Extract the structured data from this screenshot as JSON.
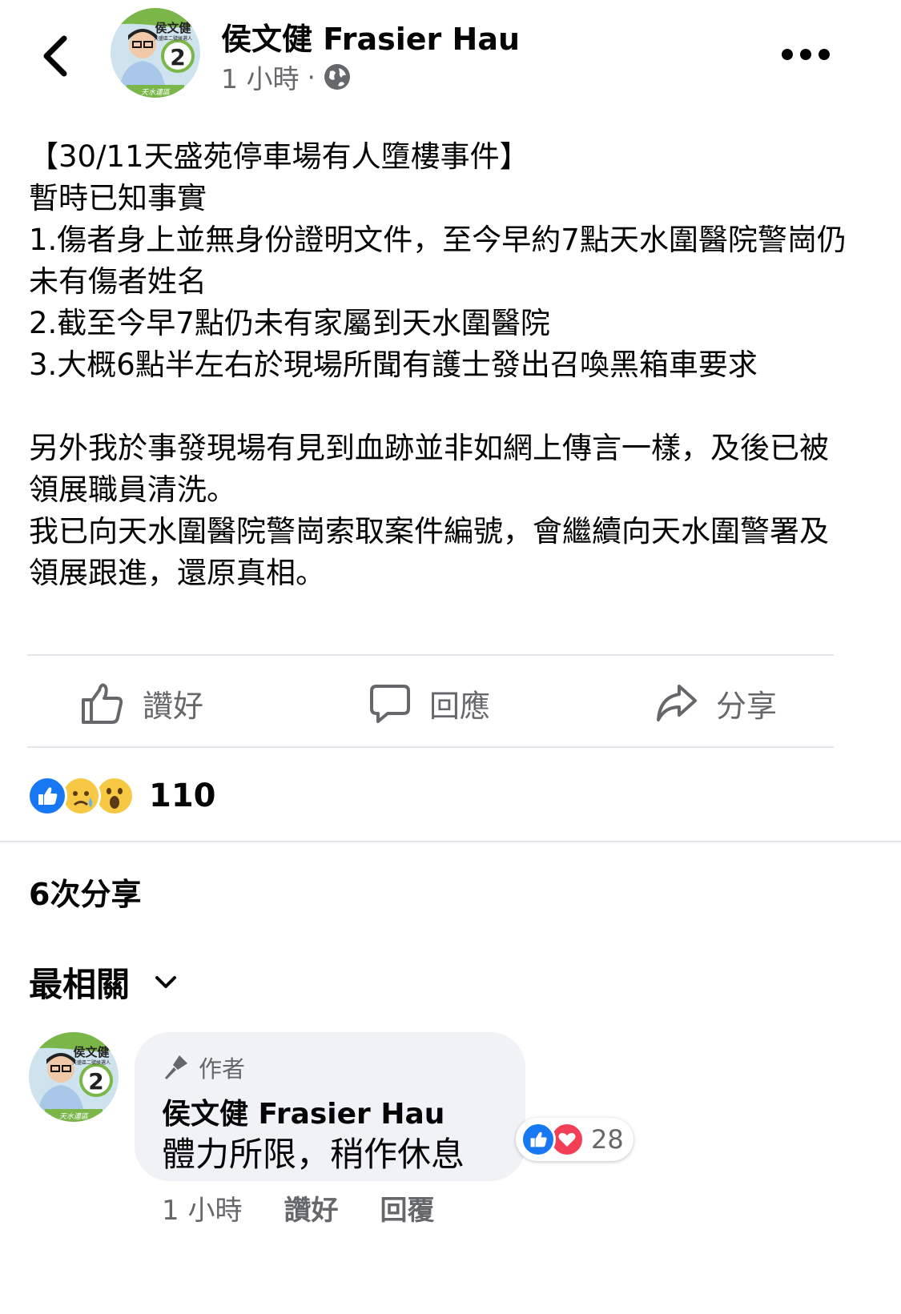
{
  "post": {
    "author": "侯文健 Frasier Hau",
    "time": "1 小時",
    "separator": "·",
    "privacy_icon": "globe-icon",
    "body": "【30/11天盛苑停車場有人墮樓事件】\n暫時已知事實\n1.傷者身上並無身份證明文件，至今早約7點天水圍醫院警崗仍未有傷者姓名\n2.截至今早7點仍未有家屬到天水圍醫院\n3.大概6點半左右於現場所聞有護士發出召喚黑箱車要求\n\n另外我於事發現場有見到血跡並非如網上傳言一樣，及後已被領展職員清洗。\n我已向天水圍醫院警崗索取案件編號，會繼續向天水圍警署及領展跟進，還原真相。"
  },
  "avatar": {
    "name_text": "侯文健",
    "sub_text": "天盛區二號候選人",
    "number": "2",
    "slogan": "天水連區"
  },
  "actions": {
    "like": "讚好",
    "comment": "回應",
    "share": "分享"
  },
  "reactions": {
    "count": "110",
    "types": [
      "like",
      "sad",
      "wow"
    ]
  },
  "shares_text": "6次分享",
  "comments_filter": "最相關",
  "comment": {
    "badge": "作者",
    "author": "侯文健 Frasier Hau",
    "text": "體力所限，稍作休息",
    "reaction_count": "28",
    "time": "1 小時",
    "like": "讚好",
    "reply": "回覆"
  },
  "colors": {
    "like_blue": "#1877f2",
    "love_red": "#f33e58",
    "emoji_yellow": "#f7c844",
    "secondary_text": "#65676b",
    "bubble_bg": "#f0f2f5",
    "avatar_green": "#7ab648"
  }
}
